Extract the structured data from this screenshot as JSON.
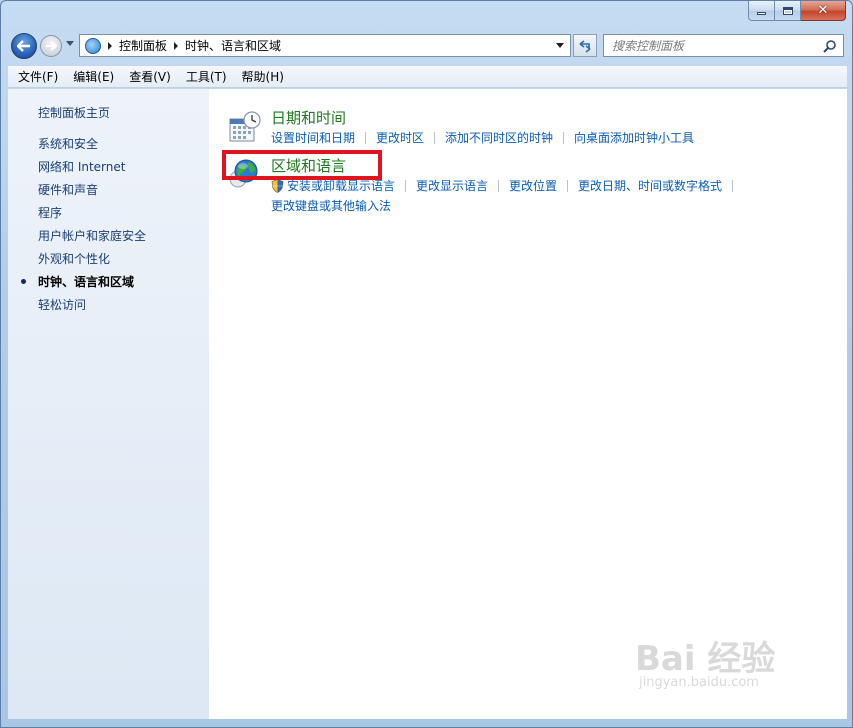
{
  "window": {
    "caption_buttons": [
      "minimize",
      "maximize",
      "close"
    ]
  },
  "address_bar": {
    "breadcrumbs": [
      "控制面板",
      "时钟、语言和区域"
    ]
  },
  "search": {
    "placeholder": "搜索控制面板"
  },
  "menubar": {
    "items": [
      "文件(F)",
      "编辑(E)",
      "查看(V)",
      "工具(T)",
      "帮助(H)"
    ]
  },
  "sidebar": {
    "home": "控制面板主页",
    "items": [
      {
        "label": "系统和安全"
      },
      {
        "label": "网络和 Internet"
      },
      {
        "label": "硬件和声音"
      },
      {
        "label": "程序"
      },
      {
        "label": "用户帐户和家庭安全"
      },
      {
        "label": "外观和个性化"
      },
      {
        "label": "时钟、语言和区域",
        "active": true
      },
      {
        "label": "轻松访问"
      }
    ]
  },
  "categories": [
    {
      "title": "日期和时间",
      "icon": "calendar-clock-icon",
      "links": [
        "设置时间和日期",
        "更改时区",
        "添加不同时区的时钟",
        "向桌面添加时钟小工具"
      ]
    },
    {
      "title": "区域和语言",
      "icon": "globe-clock-icon",
      "links_row1": [
        "安装或卸载显示语言",
        "更改显示语言",
        "更改位置",
        "更改日期、时间或数字格式"
      ],
      "links_row2": [
        "更改键盘或其他输入法"
      ]
    }
  ],
  "watermark": {
    "text": "Bai 经验",
    "sub": "jingyan.baidu.com"
  },
  "colors": {
    "highlight": "#e0141e",
    "link": "#0a5cb8",
    "category_title": "#1e7a1e"
  }
}
